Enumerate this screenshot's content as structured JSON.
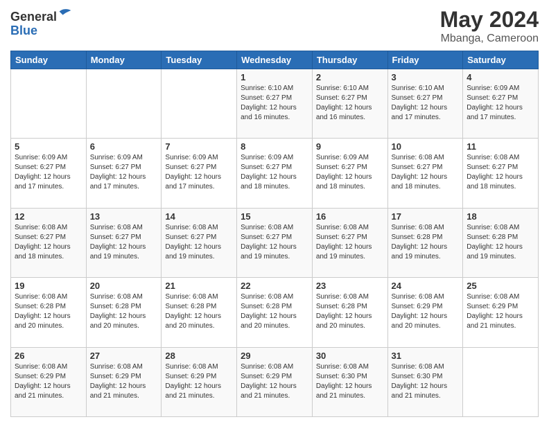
{
  "header": {
    "logo_general": "General",
    "logo_blue": "Blue",
    "month_year": "May 2024",
    "location": "Mbanga, Cameroon"
  },
  "weekdays": [
    "Sunday",
    "Monday",
    "Tuesday",
    "Wednesday",
    "Thursday",
    "Friday",
    "Saturday"
  ],
  "weeks": [
    [
      {
        "day": "",
        "info": ""
      },
      {
        "day": "",
        "info": ""
      },
      {
        "day": "",
        "info": ""
      },
      {
        "day": "1",
        "info": "Sunrise: 6:10 AM\nSunset: 6:27 PM\nDaylight: 12 hours\nand 16 minutes."
      },
      {
        "day": "2",
        "info": "Sunrise: 6:10 AM\nSunset: 6:27 PM\nDaylight: 12 hours\nand 16 minutes."
      },
      {
        "day": "3",
        "info": "Sunrise: 6:10 AM\nSunset: 6:27 PM\nDaylight: 12 hours\nand 17 minutes."
      },
      {
        "day": "4",
        "info": "Sunrise: 6:09 AM\nSunset: 6:27 PM\nDaylight: 12 hours\nand 17 minutes."
      }
    ],
    [
      {
        "day": "5",
        "info": "Sunrise: 6:09 AM\nSunset: 6:27 PM\nDaylight: 12 hours\nand 17 minutes."
      },
      {
        "day": "6",
        "info": "Sunrise: 6:09 AM\nSunset: 6:27 PM\nDaylight: 12 hours\nand 17 minutes."
      },
      {
        "day": "7",
        "info": "Sunrise: 6:09 AM\nSunset: 6:27 PM\nDaylight: 12 hours\nand 17 minutes."
      },
      {
        "day": "8",
        "info": "Sunrise: 6:09 AM\nSunset: 6:27 PM\nDaylight: 12 hours\nand 18 minutes."
      },
      {
        "day": "9",
        "info": "Sunrise: 6:09 AM\nSunset: 6:27 PM\nDaylight: 12 hours\nand 18 minutes."
      },
      {
        "day": "10",
        "info": "Sunrise: 6:08 AM\nSunset: 6:27 PM\nDaylight: 12 hours\nand 18 minutes."
      },
      {
        "day": "11",
        "info": "Sunrise: 6:08 AM\nSunset: 6:27 PM\nDaylight: 12 hours\nand 18 minutes."
      }
    ],
    [
      {
        "day": "12",
        "info": "Sunrise: 6:08 AM\nSunset: 6:27 PM\nDaylight: 12 hours\nand 18 minutes."
      },
      {
        "day": "13",
        "info": "Sunrise: 6:08 AM\nSunset: 6:27 PM\nDaylight: 12 hours\nand 19 minutes."
      },
      {
        "day": "14",
        "info": "Sunrise: 6:08 AM\nSunset: 6:27 PM\nDaylight: 12 hours\nand 19 minutes."
      },
      {
        "day": "15",
        "info": "Sunrise: 6:08 AM\nSunset: 6:27 PM\nDaylight: 12 hours\nand 19 minutes."
      },
      {
        "day": "16",
        "info": "Sunrise: 6:08 AM\nSunset: 6:27 PM\nDaylight: 12 hours\nand 19 minutes."
      },
      {
        "day": "17",
        "info": "Sunrise: 6:08 AM\nSunset: 6:28 PM\nDaylight: 12 hours\nand 19 minutes."
      },
      {
        "day": "18",
        "info": "Sunrise: 6:08 AM\nSunset: 6:28 PM\nDaylight: 12 hours\nand 19 minutes."
      }
    ],
    [
      {
        "day": "19",
        "info": "Sunrise: 6:08 AM\nSunset: 6:28 PM\nDaylight: 12 hours\nand 20 minutes."
      },
      {
        "day": "20",
        "info": "Sunrise: 6:08 AM\nSunset: 6:28 PM\nDaylight: 12 hours\nand 20 minutes."
      },
      {
        "day": "21",
        "info": "Sunrise: 6:08 AM\nSunset: 6:28 PM\nDaylight: 12 hours\nand 20 minutes."
      },
      {
        "day": "22",
        "info": "Sunrise: 6:08 AM\nSunset: 6:28 PM\nDaylight: 12 hours\nand 20 minutes."
      },
      {
        "day": "23",
        "info": "Sunrise: 6:08 AM\nSunset: 6:28 PM\nDaylight: 12 hours\nand 20 minutes."
      },
      {
        "day": "24",
        "info": "Sunrise: 6:08 AM\nSunset: 6:29 PM\nDaylight: 12 hours\nand 20 minutes."
      },
      {
        "day": "25",
        "info": "Sunrise: 6:08 AM\nSunset: 6:29 PM\nDaylight: 12 hours\nand 21 minutes."
      }
    ],
    [
      {
        "day": "26",
        "info": "Sunrise: 6:08 AM\nSunset: 6:29 PM\nDaylight: 12 hours\nand 21 minutes."
      },
      {
        "day": "27",
        "info": "Sunrise: 6:08 AM\nSunset: 6:29 PM\nDaylight: 12 hours\nand 21 minutes."
      },
      {
        "day": "28",
        "info": "Sunrise: 6:08 AM\nSunset: 6:29 PM\nDaylight: 12 hours\nand 21 minutes."
      },
      {
        "day": "29",
        "info": "Sunrise: 6:08 AM\nSunset: 6:29 PM\nDaylight: 12 hours\nand 21 minutes."
      },
      {
        "day": "30",
        "info": "Sunrise: 6:08 AM\nSunset: 6:30 PM\nDaylight: 12 hours\nand 21 minutes."
      },
      {
        "day": "31",
        "info": "Sunrise: 6:08 AM\nSunset: 6:30 PM\nDaylight: 12 hours\nand 21 minutes."
      },
      {
        "day": "",
        "info": ""
      }
    ]
  ]
}
